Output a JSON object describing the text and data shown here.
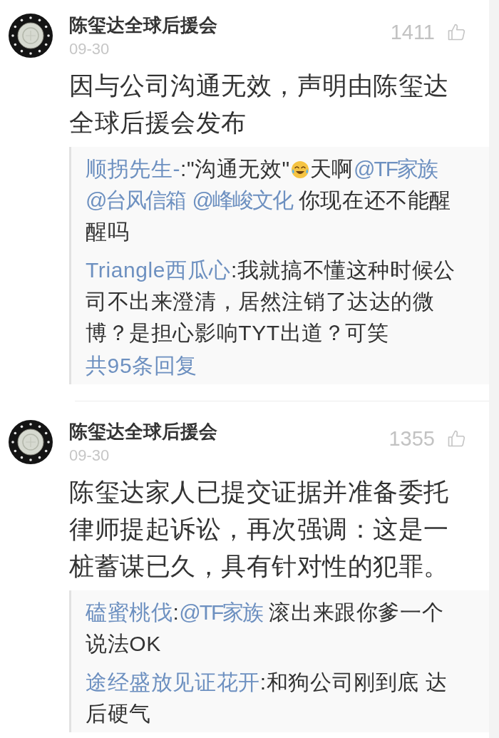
{
  "comments": [
    {
      "author": "陈玺达全球后援会",
      "date": "09-30",
      "likes": "1411",
      "body": "因与公司沟通无效，声明由陈玺达全球后援会发布",
      "replies": [
        {
          "author": "顺拐先生-",
          "segments": [
            {
              "kind": "text",
              "text": ":\"沟通无效\""
            },
            {
              "kind": "emoji"
            },
            {
              "kind": "text",
              "text": "天啊"
            },
            {
              "kind": "mention",
              "text": "@TF家族"
            },
            {
              "kind": "mention",
              "text": "@台风信箱"
            },
            {
              "kind": "mention",
              "text": "@峰峻文化"
            },
            {
              "kind": "text",
              "text": "你现在还不能醒醒吗"
            }
          ]
        },
        {
          "author": "Triangle西瓜心",
          "segments": [
            {
              "kind": "text",
              "text": ":我就搞不懂这种时候公司不出来澄清，居然注销了达达的微博？是担心影响TYT出道？可笑"
            }
          ]
        }
      ],
      "more_replies": "共95条回复"
    },
    {
      "author": "陈玺达全球后援会",
      "date": "09-30",
      "likes": "1355",
      "body": "陈玺达家人已提交证据并准备委托律师提起诉讼，再次强调：这是一桩蓄谋已久，具有针对性的犯罪。",
      "replies": [
        {
          "author": "磕蜜桃伐",
          "segments": [
            {
              "kind": "text",
              "text": ":"
            },
            {
              "kind": "mention",
              "text": "@TF家族"
            },
            {
              "kind": "text",
              "text": "滚出来跟你爹一个说法OK"
            }
          ]
        },
        {
          "author": "途经盛放见证花开",
          "segments": [
            {
              "kind": "text",
              "text": ":和狗公司刚到底 达后硬气"
            }
          ]
        }
      ]
    }
  ]
}
